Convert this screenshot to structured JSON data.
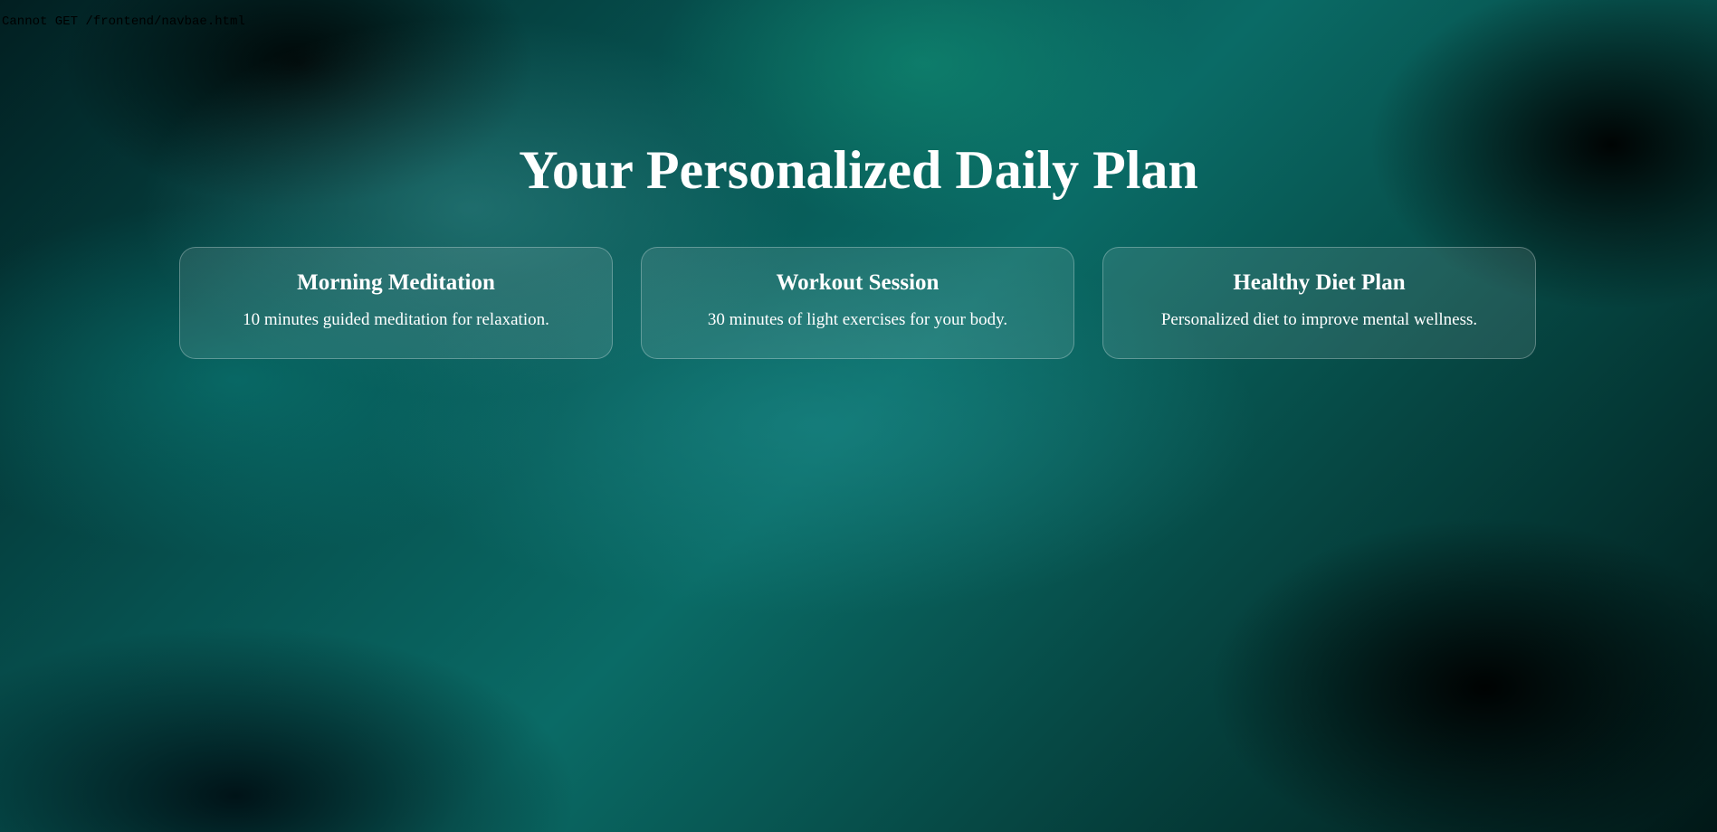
{
  "error_message": "Cannot GET /frontend/navbae.html",
  "page": {
    "title": "Your Personalized Daily Plan"
  },
  "cards": [
    {
      "title": "Morning Meditation",
      "description": "10 minutes guided meditation for relaxation."
    },
    {
      "title": "Workout Session",
      "description": "30 minutes of light exercises for your body."
    },
    {
      "title": "Healthy Diet Plan",
      "description": "Personalized diet to improve mental wellness."
    }
  ],
  "colors": {
    "text": "#ffffff",
    "background_teal": "#0a6b66",
    "background_dark": "#021f21"
  }
}
